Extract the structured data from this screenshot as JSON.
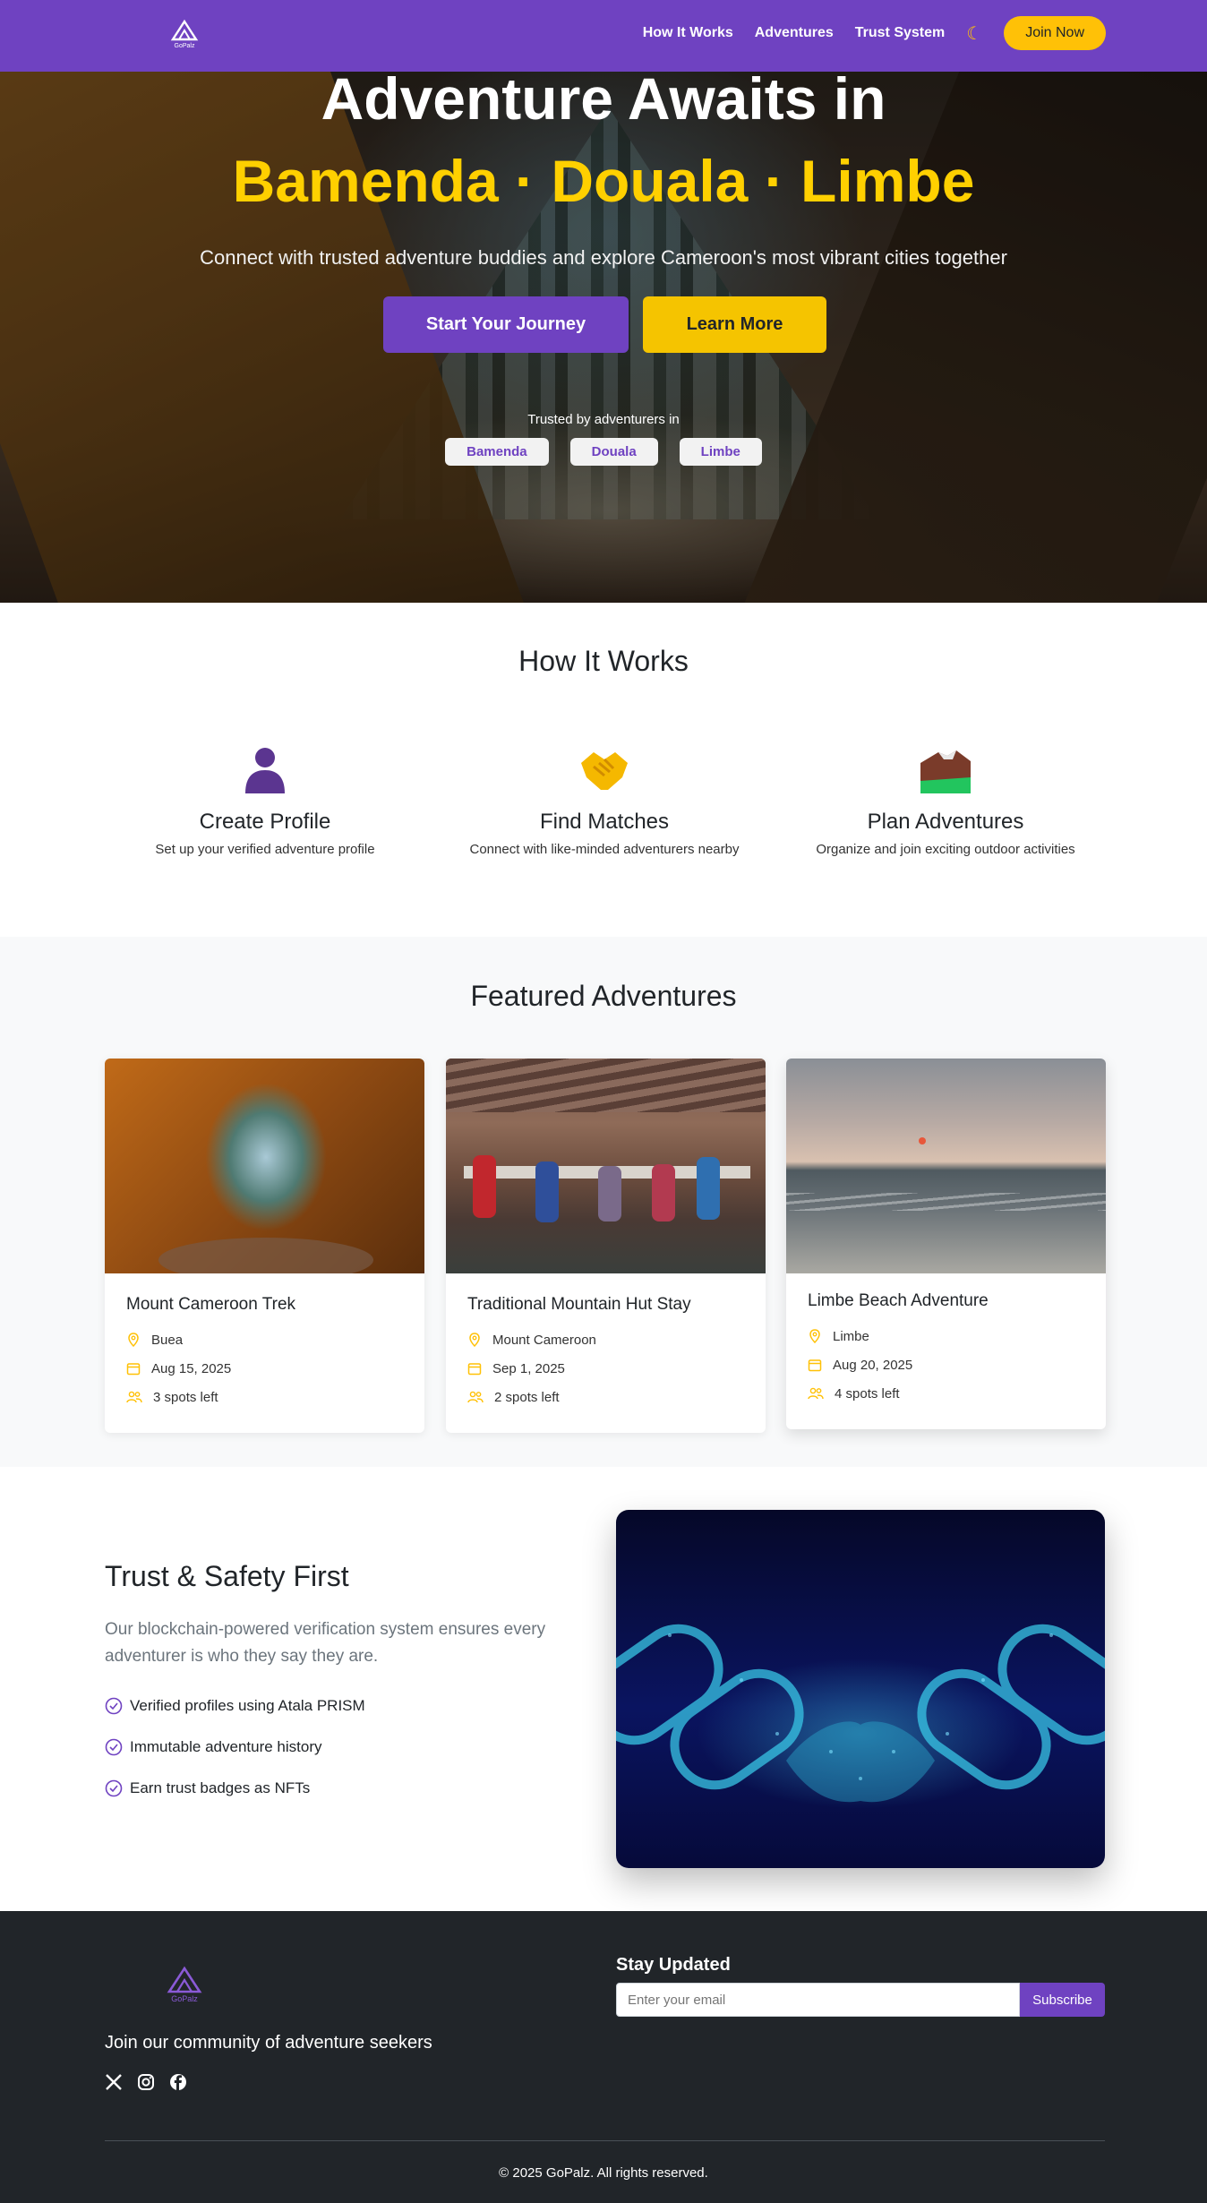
{
  "brand": {
    "name": "GoPalz",
    "colors": {
      "primary": "#6f42c1",
      "accent": "#ffc107",
      "dark": "#212529"
    }
  },
  "nav": {
    "links": [
      {
        "label": "How It Works"
      },
      {
        "label": "Adventures"
      },
      {
        "label": "Trust System"
      }
    ],
    "theme_icon": "moon-icon",
    "join_label": "Join Now"
  },
  "hero": {
    "title_line1": "Adventure Awaits in",
    "title_line2": "Bamenda · Douala · Limbe",
    "subtitle": "Connect with trusted adventure buddies and explore Cameroon's most vibrant cities together",
    "primary_cta": "Start Your Journey",
    "secondary_cta": "Learn More",
    "trusted_text": "Trusted by adventurers in",
    "cities": [
      "Bamenda",
      "Douala",
      "Limbe"
    ]
  },
  "how_it_works": {
    "title": "How It Works",
    "steps": [
      {
        "icon": "person-silhouette-icon",
        "title": "Create Profile",
        "desc": "Set up your verified adventure profile"
      },
      {
        "icon": "handshake-icon",
        "title": "Find Matches",
        "desc": "Connect with like-minded adventurers nearby"
      },
      {
        "icon": "mountain-icon",
        "title": "Plan Adventures",
        "desc": "Organize and join exciting outdoor activities"
      }
    ]
  },
  "featured": {
    "title": "Featured Adventures",
    "cards": [
      {
        "title": "Mount Cameroon Trek",
        "location": "Buea",
        "date": "Aug 15, 2025",
        "spots": "3 spots left"
      },
      {
        "title": "Traditional Mountain Hut Stay",
        "location": "Mount Cameroon",
        "date": "Sep 1, 2025",
        "spots": "2 spots left"
      },
      {
        "title": "Limbe Beach Adventure",
        "location": "Limbe",
        "date": "Aug 20, 2025",
        "spots": "4 spots left"
      }
    ]
  },
  "trust": {
    "title": "Trust & Safety First",
    "desc": "Our blockchain-powered verification system ensures every adventurer is who they say they are.",
    "items": [
      "Verified profiles using Atala PRISM",
      "Immutable adventure history",
      "Earn trust badges as NFTs"
    ]
  },
  "footer": {
    "tagline": "Join our community of adventure seekers",
    "socials": [
      "x-icon",
      "instagram-icon",
      "facebook-icon"
    ],
    "stay_title": "Stay Updated",
    "email_placeholder": "Enter your email",
    "subscribe_label": "Subscribe",
    "copyright": "© 2025 GoPalz. All rights reserved."
  }
}
